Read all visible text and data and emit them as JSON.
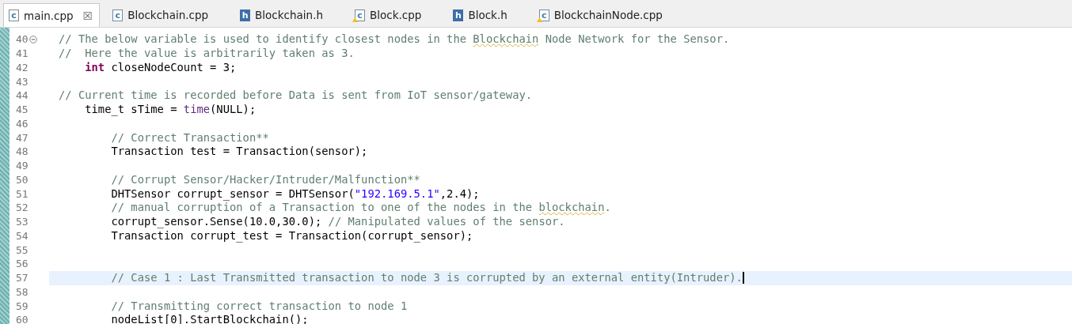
{
  "tabs": [
    {
      "label": "main.cpp",
      "type": "c",
      "warning": false,
      "selected": true,
      "close": "☒"
    },
    {
      "label": "Blockchain.cpp",
      "type": "c",
      "warning": false,
      "selected": false
    },
    {
      "label": "Blockchain.h",
      "type": "h",
      "warning": false,
      "selected": false
    },
    {
      "label": "Block.cpp",
      "type": "c",
      "warning": true,
      "selected": false
    },
    {
      "label": "Block.h",
      "type": "h",
      "warning": false,
      "selected": false
    },
    {
      "label": "BlockchainNode.cpp",
      "type": "c",
      "warning": true,
      "selected": false
    }
  ],
  "editor": {
    "lines": [
      {
        "number": "40",
        "fold": true,
        "current": false,
        "tokens": [
          {
            "kind": "comment",
            "text": "// The below variable is used to identify closest nodes in the "
          },
          {
            "kind": "spell",
            "text": "Blockchain"
          },
          {
            "kind": "comment",
            "text": " Node Network for the Sensor."
          }
        ]
      },
      {
        "number": "41",
        "fold": false,
        "current": false,
        "tokens": [
          {
            "kind": "comment",
            "text": "//  Here the value is arbitrarily taken as 3."
          }
        ]
      },
      {
        "number": "42",
        "fold": false,
        "current": false,
        "tokens": [
          {
            "kind": "keyword",
            "text": "    int"
          },
          {
            "kind": "plain",
            "text": " closeNodeCount = 3;"
          }
        ]
      },
      {
        "number": "43",
        "fold": false,
        "current": false
      },
      {
        "number": "44",
        "fold": false,
        "current": false,
        "tokens": [
          {
            "kind": "comment",
            "text": "// Current time is recorded before Data is sent from IoT sensor/gateway."
          }
        ]
      },
      {
        "number": "45",
        "fold": false,
        "current": false,
        "tokens": [
          {
            "kind": "plain",
            "text": "    time_t sTime = "
          },
          {
            "kind": "function",
            "text": "time"
          },
          {
            "kind": "plain",
            "text": "(NULL);"
          }
        ]
      },
      {
        "number": "46",
        "fold": false,
        "current": false
      },
      {
        "number": "47",
        "fold": false,
        "current": false,
        "tokens": [
          {
            "kind": "comment",
            "text": "        // Correct Transaction**"
          }
        ]
      },
      {
        "number": "48",
        "fold": false,
        "current": false,
        "tokens": [
          {
            "kind": "plain",
            "text": "        Transaction test = Transaction(sensor);"
          }
        ]
      },
      {
        "number": "49",
        "fold": false,
        "current": false
      },
      {
        "number": "50",
        "fold": false,
        "current": false,
        "tokens": [
          {
            "kind": "comment",
            "text": "        // Corrupt Sensor/Hacker/Intruder/Malfunction**"
          }
        ]
      },
      {
        "number": "51",
        "fold": false,
        "current": false,
        "tokens": [
          {
            "kind": "plain",
            "text": "        DHTSensor corrupt_sensor = DHTSensor("
          },
          {
            "kind": "string",
            "text": "\"192.169.5.1\""
          },
          {
            "kind": "plain",
            "text": ",2.4);"
          }
        ]
      },
      {
        "number": "52",
        "fold": false,
        "current": false,
        "tokens": [
          {
            "kind": "comment",
            "text": "        // manual corruption of a Transaction to one of the nodes in the "
          },
          {
            "kind": "spell",
            "text": "blockchain"
          },
          {
            "kind": "comment",
            "text": "."
          }
        ]
      },
      {
        "number": "53",
        "fold": false,
        "current": false,
        "tokens": [
          {
            "kind": "plain",
            "text": "        corrupt_sensor.Sense(10.0,30.0); "
          },
          {
            "kind": "comment",
            "text": "// Manipulated values of the sensor."
          }
        ]
      },
      {
        "number": "54",
        "fold": false,
        "current": false,
        "tokens": [
          {
            "kind": "plain",
            "text": "        Transaction corrupt_test = Transaction(corrupt_sensor);"
          }
        ]
      },
      {
        "number": "55",
        "fold": false,
        "current": false
      },
      {
        "number": "56",
        "fold": false,
        "current": false
      },
      {
        "number": "57",
        "fold": false,
        "current": true,
        "tokens": [
          {
            "kind": "comment",
            "text": "        // Case 1 : Last Transmitted transaction to node 3 is corrupted by an external entity(Intruder)."
          }
        ]
      },
      {
        "number": "58",
        "fold": false,
        "current": false
      },
      {
        "number": "59",
        "fold": false,
        "current": false,
        "tokens": [
          {
            "kind": "comment",
            "text": "        // Transmitting correct transaction to node 1"
          }
        ]
      },
      {
        "number": "60",
        "fold": false,
        "current": false,
        "tokens": [
          {
            "kind": "plain",
            "text": "        nodeList[0].StartBlockchain();"
          }
        ]
      }
    ]
  }
}
